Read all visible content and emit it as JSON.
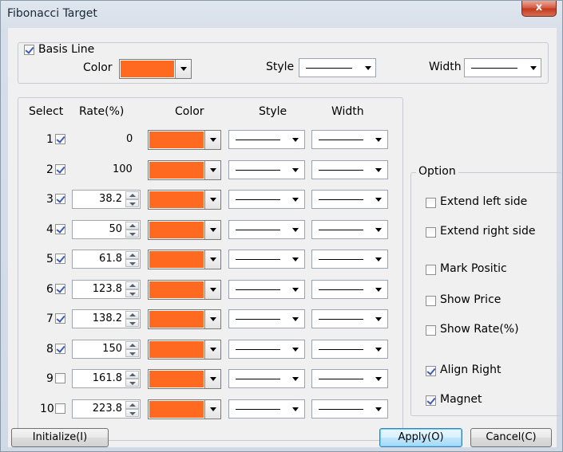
{
  "window": {
    "title": "Fibonacci Target",
    "close_label": "x"
  },
  "basis_line": {
    "checkbox_label": "Basis Line",
    "checked": true,
    "color_label": "Color",
    "color": "#ff6a20",
    "style_label": "Style",
    "width_label": "Width"
  },
  "table": {
    "headers": [
      "Select",
      "Rate(%)",
      "Color",
      "Style",
      "Width"
    ],
    "rows": [
      {
        "index": "1",
        "checked": true,
        "rate": "0",
        "editable": false,
        "color": "#ff6a20"
      },
      {
        "index": "2",
        "checked": true,
        "rate": "100",
        "editable": false,
        "color": "#ff6a20"
      },
      {
        "index": "3",
        "checked": true,
        "rate": "38.2",
        "editable": true,
        "color": "#ff6a20"
      },
      {
        "index": "4",
        "checked": true,
        "rate": "50",
        "editable": true,
        "color": "#ff6a20"
      },
      {
        "index": "5",
        "checked": true,
        "rate": "61.8",
        "editable": true,
        "color": "#ff6a20"
      },
      {
        "index": "6",
        "checked": true,
        "rate": "123.8",
        "editable": true,
        "color": "#ff6a20"
      },
      {
        "index": "7",
        "checked": true,
        "rate": "138.2",
        "editable": true,
        "color": "#ff6a20"
      },
      {
        "index": "8",
        "checked": true,
        "rate": "150",
        "editable": true,
        "color": "#ff6a20"
      },
      {
        "index": "9",
        "checked": false,
        "rate": "161.8",
        "editable": true,
        "color": "#ff6a20"
      },
      {
        "index": "10",
        "checked": false,
        "rate": "223.8",
        "editable": true,
        "color": "#ff6a20"
      }
    ]
  },
  "option": {
    "title": "Option",
    "items": [
      {
        "label": "Extend left side",
        "checked": false
      },
      {
        "label": "Extend right side",
        "checked": false
      },
      {
        "label": "Mark Positic",
        "checked": false
      },
      {
        "label": "Show Price",
        "checked": false
      },
      {
        "label": "Show Rate(%)",
        "checked": false
      },
      {
        "label": "Align Right",
        "checked": true
      },
      {
        "label": "Magnet",
        "checked": true
      }
    ]
  },
  "buttons": {
    "initialize": "Initialize(I)",
    "apply": "Apply(O)",
    "cancel": "Cancel(C)"
  }
}
